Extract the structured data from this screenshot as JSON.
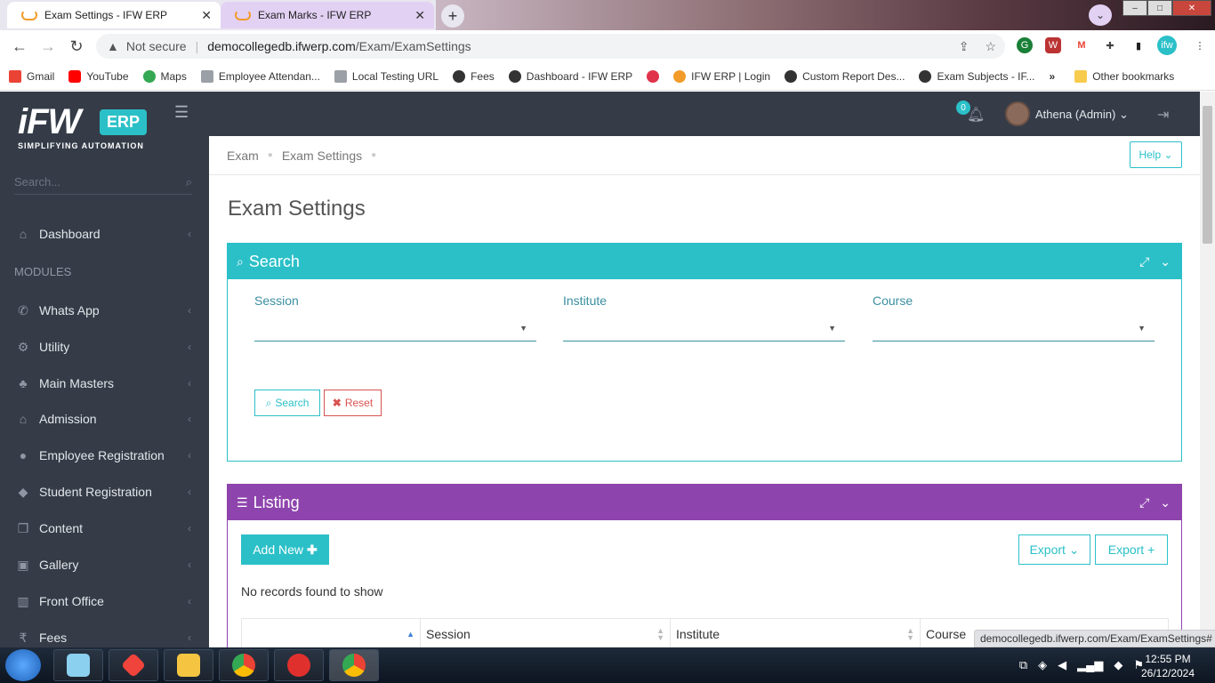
{
  "browser": {
    "tabs": [
      {
        "title": "Exam Settings - IFW ERP",
        "active": true
      },
      {
        "title": "Exam Marks - IFW ERP",
        "active": false
      }
    ],
    "new_tab": "+",
    "close": "✕",
    "address": {
      "security": "Not secure",
      "host": "democollegedb.ifwerp.com",
      "path": "/Exam/ExamSettings"
    },
    "bookmarks": [
      {
        "label": "Gmail",
        "color": "#ea4335"
      },
      {
        "label": "YouTube",
        "color": "#ff0000"
      },
      {
        "label": "Maps",
        "color": "#34a853"
      },
      {
        "label": "Employee Attendan...",
        "color": "#9aa0a6"
      },
      {
        "label": "Local Testing URL",
        "color": "#9aa0a6"
      },
      {
        "label": "Fees",
        "color": "#333333"
      },
      {
        "label": "Dashboard - IFW ERP",
        "color": "#333333"
      },
      {
        "label": "",
        "color": "#e0334b"
      },
      {
        "label": "IFW ERP | Login",
        "color": "#f29b29"
      },
      {
        "label": "Custom Report Des...",
        "color": "#333333"
      },
      {
        "label": "Exam Subjects - IF...",
        "color": "#333333"
      }
    ],
    "more_bookmarks": "»",
    "other_bookmarks": "Other bookmarks",
    "status_link": "democollegedb.ifwerp.com/Exam/ExamSettings#"
  },
  "app": {
    "logo": {
      "brand": "iFW",
      "erp": "ERP",
      "tagline": "SIMPLIFYING AUTOMATION"
    },
    "sidebar": {
      "search_placeholder": "Search...",
      "dashboard": "Dashboard",
      "modules_header": "MODULES",
      "items": [
        {
          "label": "Whats App",
          "icon": "whatsapp-icon"
        },
        {
          "label": "Utility",
          "icon": "gears-icon"
        },
        {
          "label": "Main Masters",
          "icon": "sitemap-icon"
        },
        {
          "label": "Admission",
          "icon": "bank-icon"
        },
        {
          "label": "Employee Registration",
          "icon": "user-icon"
        },
        {
          "label": "Student Registration",
          "icon": "graduation-cap-icon"
        },
        {
          "label": "Content",
          "icon": "copy-icon"
        },
        {
          "label": "Gallery",
          "icon": "image-icon"
        },
        {
          "label": "Front Office",
          "icon": "building-icon"
        },
        {
          "label": "Fees",
          "icon": "rupee-icon"
        }
      ]
    },
    "topbar": {
      "notifications": "0",
      "user": "Athena (Admin)"
    },
    "breadcrumb": [
      "Exam",
      "Exam Settings"
    ],
    "help": "Help",
    "page_title": "Exam Settings",
    "search_panel": {
      "title": "Search",
      "fields": [
        {
          "label": "Session",
          "value": ""
        },
        {
          "label": "Institute",
          "value": ""
        },
        {
          "label": "Course",
          "value": ""
        }
      ],
      "search_btn": "Search",
      "reset_btn": "Reset"
    },
    "listing_panel": {
      "title": "Listing",
      "add_new": "Add New",
      "export_dropdown": "Export",
      "export_plus": "Export +",
      "empty_message": "No records found to show",
      "columns": [
        "",
        "Session",
        "Institute",
        "Course"
      ]
    }
  },
  "taskbar": {
    "time": "12:55 PM",
    "date": "26/12/2024"
  },
  "colors": {
    "accent": "#2bc0c8",
    "listing": "#8e44ad",
    "sidebar": "#353c48",
    "danger": "#d9534f"
  }
}
